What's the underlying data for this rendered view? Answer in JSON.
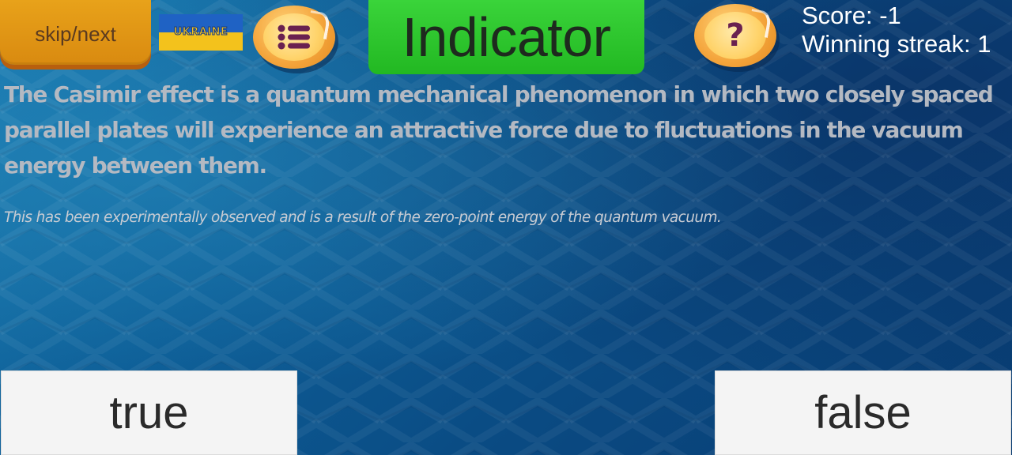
{
  "header": {
    "skip_label": "skip/next",
    "flag_label": "UKRAINE",
    "title": "Indicator",
    "help_symbol": "?",
    "score_line": "Score: -1",
    "streak_line": "Winning streak: 1"
  },
  "question": {
    "statement": "The Casimir effect is a quantum mechanical phenomenon in which two closely spaced parallel plates will experience an attractive force due to fluctuations in the vacuum energy between them.",
    "explanation": "This has been experimentally observed and is a result of the zero-point energy of the quantum vacuum."
  },
  "answers": {
    "true_label": "true",
    "false_label": "false"
  },
  "icons": {
    "menu": "list-icon",
    "help": "question-mark-icon",
    "flag": "ukraine-flag-icon"
  },
  "colors": {
    "skip_button": "#e09416",
    "title_button": "#2cc62c",
    "round_buttons": "#f4a53c",
    "background": "#0d5d96",
    "answer_buttons": "#f4f4f4"
  }
}
